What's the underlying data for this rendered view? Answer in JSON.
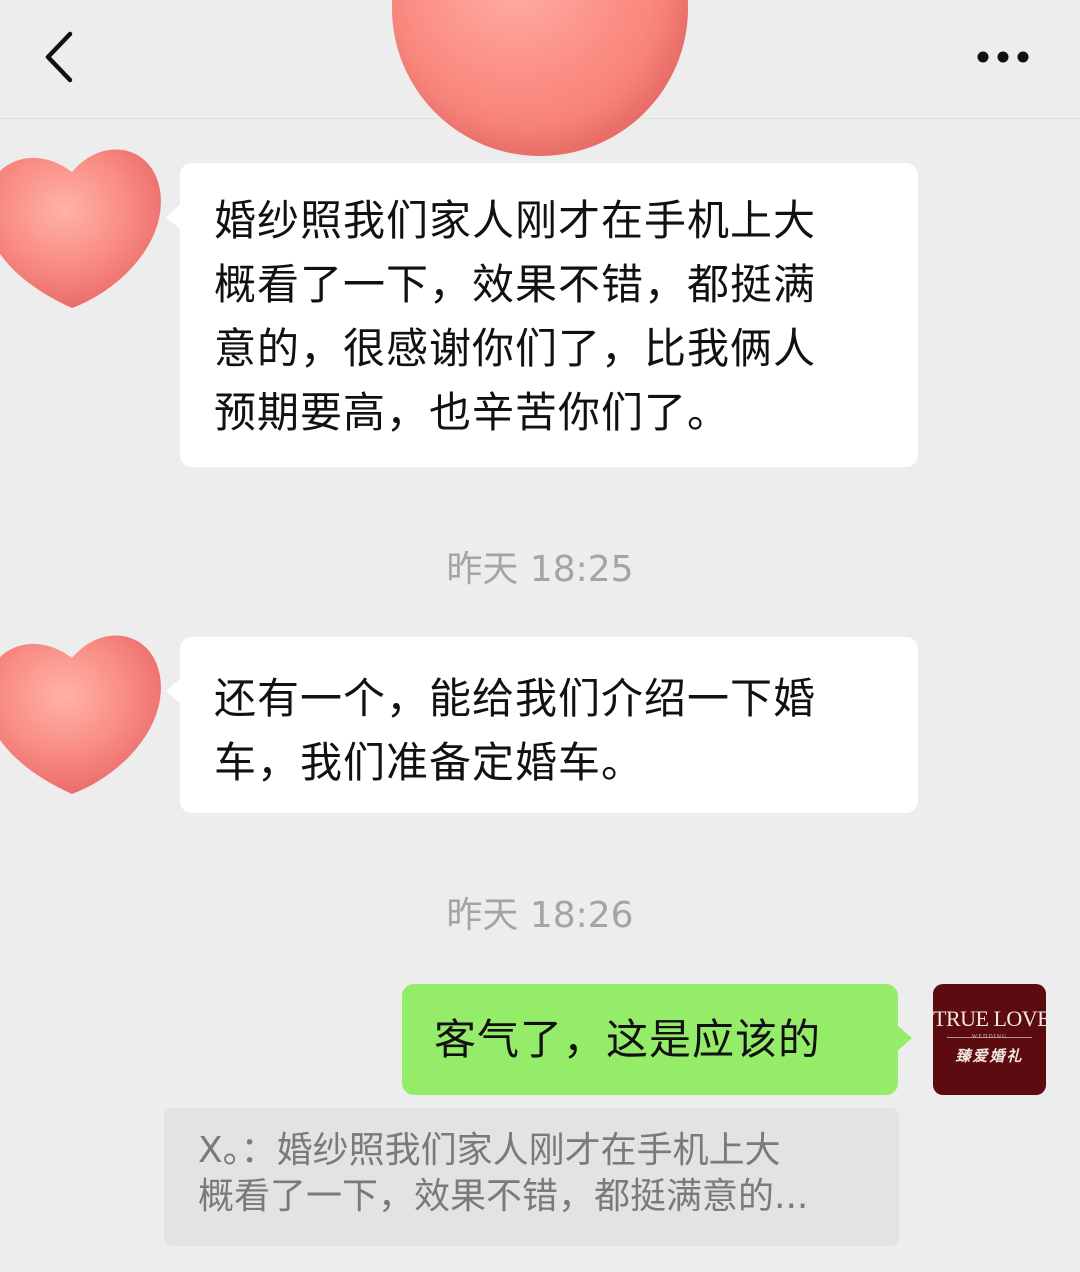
{
  "header": {
    "back_icon": "chevron-left-icon",
    "more_icon": "ellipsis-icon"
  },
  "messages": [
    {
      "direction": "incoming",
      "text": "婚纱照我们家人刚才在手机上大\n概看了一下，效果不错，都挺满\n意的，很感谢你们了，比我俩人\n预期要高，也辛苦你们了。"
    },
    {
      "timestamp": "昨天 18:25"
    },
    {
      "direction": "incoming",
      "text": "还有一个，能给我们介绍一下婚\n车，我们准备定婚车。"
    },
    {
      "timestamp": "昨天 18:26"
    },
    {
      "direction": "outgoing",
      "text": "客气了，这是应该的"
    }
  ],
  "my_avatar": {
    "logo_text": "TRUE LOVE",
    "logo_sub": "WEDDING",
    "logo_cn": "臻爱婚礼",
    "bg_color": "#5c0c10"
  },
  "quote": {
    "text": "X。：婚纱照我们家人刚才在手机上大\n概看了一下，效果不错，都挺满意的..."
  },
  "colors": {
    "background": "#ededed",
    "incoming_bubble": "#ffffff",
    "outgoing_bubble": "#95ec69",
    "timestamp": "#a4a4a4",
    "privacy_sticker": "#fb8d83"
  }
}
